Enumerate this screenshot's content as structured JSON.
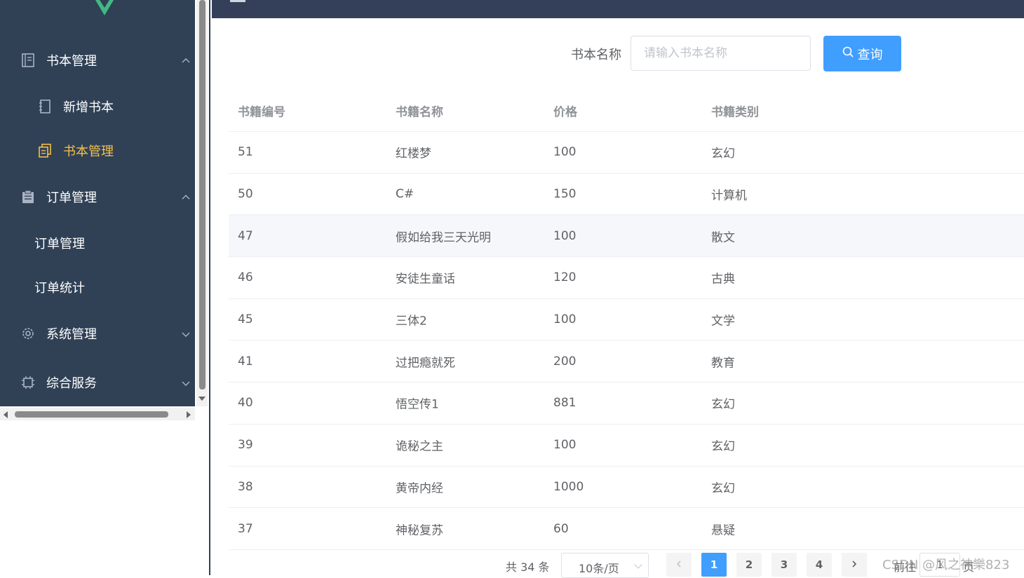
{
  "sidebar": {
    "items": [
      {
        "label": "书本管理",
        "icon": "book-icon"
      },
      {
        "label": "新增书本",
        "icon": "notebook-icon"
      },
      {
        "label": "书本管理",
        "icon": "copy-icon",
        "active": true
      },
      {
        "label": "订单管理",
        "icon": "clipboard-icon"
      },
      {
        "label": "订单管理"
      },
      {
        "label": "订单统计"
      },
      {
        "label": "系统管理",
        "icon": "gear-icon"
      },
      {
        "label": "综合服务",
        "icon": "cpu-icon"
      }
    ],
    "active_color": "#f4c04a",
    "bg_color": "#304156"
  },
  "search": {
    "label": "书本名称",
    "placeholder": "请输入书本名称",
    "button_label": "查询",
    "button_color": "#409eff"
  },
  "table": {
    "headers": [
      "书籍编号",
      "书籍名称",
      "价格",
      "书籍类别"
    ],
    "rows": [
      [
        "51",
        "红楼梦",
        "100",
        "玄幻"
      ],
      [
        "50",
        "C#",
        "150",
        "计算机"
      ],
      [
        "47",
        "假如给我三天光明",
        "100",
        "散文"
      ],
      [
        "46",
        "安徒生童话",
        "120",
        "古典"
      ],
      [
        "45",
        "三体2",
        "100",
        "文学"
      ],
      [
        "41",
        "过把瘾就死",
        "200",
        "教育"
      ],
      [
        "40",
        "悟空传1",
        "881",
        "玄幻"
      ],
      [
        "39",
        "诡秘之主",
        "100",
        "玄幻"
      ],
      [
        "38",
        "黄帝内经",
        "1000",
        "玄幻"
      ],
      [
        "37",
        "神秘复苏",
        "60",
        "悬疑"
      ]
    ]
  },
  "pagination": {
    "total_text": "共 34 条",
    "page_size": "10条/页",
    "pages": [
      "1",
      "2",
      "3",
      "4"
    ],
    "current": "1",
    "jumper_prefix": "前往",
    "jumper_value": "1",
    "jumper_suffix": "页"
  },
  "watermark": "CSDN @风之神樂823"
}
